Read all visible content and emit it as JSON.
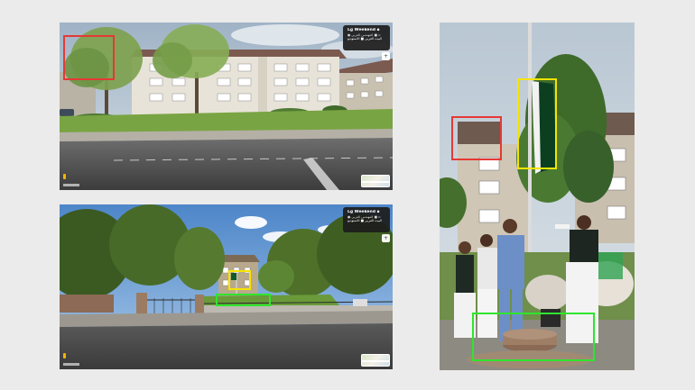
{
  "colors": {
    "page_background": "#ebebeb",
    "marker_red": "#e53935",
    "marker_yellow": "#f5e400",
    "marker_green": "#2ee52e"
  },
  "panels": {
    "street_view_top": {
      "info_card": {
        "title": "Lg Weekend ▪",
        "subtitle": "● المهندس العربي ■ ▫",
        "address": "البيت العربي ■ الاستوديو"
      }
    },
    "street_view_bottom": {
      "info_card": {
        "title": "Lg Weekend ▪",
        "subtitle": "● المهندس العربي ■ ▫",
        "address": "البيت العربي ■ الاستوديو"
      }
    }
  },
  "icons": {
    "zoom_in": "plus-icon",
    "zoom_out": "minus-icon",
    "compass": "compass-icon",
    "pegman": "pegman-icon"
  },
  "markers": [
    {
      "panel": "street_view_top",
      "color": "red",
      "label": "building-corner"
    },
    {
      "panel": "street_view_bottom",
      "color": "yellow",
      "label": "flag-location"
    },
    {
      "panel": "street_view_bottom",
      "color": "green",
      "label": "flagpole-base"
    },
    {
      "panel": "ceremony_photo",
      "color": "red",
      "label": "building-corner"
    },
    {
      "panel": "ceremony_photo",
      "color": "yellow",
      "label": "flag"
    },
    {
      "panel": "ceremony_photo",
      "color": "green",
      "label": "flagpole-base"
    }
  ]
}
